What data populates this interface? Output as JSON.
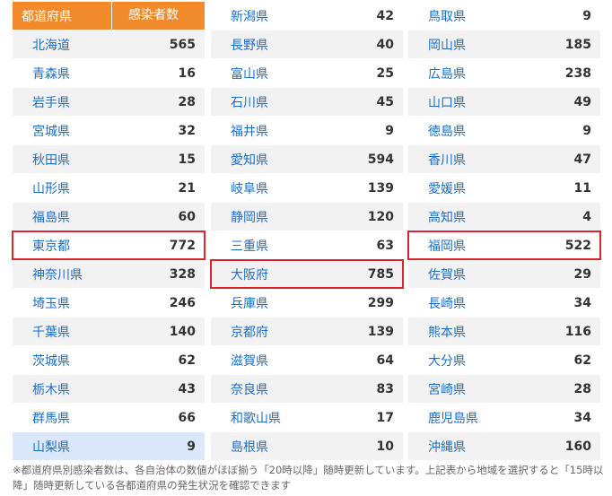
{
  "header": {
    "prefecture": "都道府県",
    "cases": "感染者数"
  },
  "columns": [
    [
      {
        "name": "北海道",
        "value": "565"
      },
      {
        "name": "青森県",
        "value": "16"
      },
      {
        "name": "岩手県",
        "value": "28"
      },
      {
        "name": "宮城県",
        "value": "32"
      },
      {
        "name": "秋田県",
        "value": "15"
      },
      {
        "name": "山形県",
        "value": "21"
      },
      {
        "name": "福島県",
        "value": "60"
      },
      {
        "name": "東京都",
        "value": "772"
      },
      {
        "name": "神奈川県",
        "value": "328"
      },
      {
        "name": "埼玉県",
        "value": "246"
      },
      {
        "name": "千葉県",
        "value": "140"
      },
      {
        "name": "茨城県",
        "value": "62"
      },
      {
        "name": "栃木県",
        "value": "43"
      },
      {
        "name": "群馬県",
        "value": "66"
      },
      {
        "name": "山梨県",
        "value": "9"
      }
    ],
    [
      {
        "name": "新潟県",
        "value": "42"
      },
      {
        "name": "長野県",
        "value": "40"
      },
      {
        "name": "富山県",
        "value": "25"
      },
      {
        "name": "石川県",
        "value": "45"
      },
      {
        "name": "福井県",
        "value": "9"
      },
      {
        "name": "愛知県",
        "value": "594"
      },
      {
        "name": "岐阜県",
        "value": "139"
      },
      {
        "name": "静岡県",
        "value": "120"
      },
      {
        "name": "三重県",
        "value": "63"
      },
      {
        "name": "大阪府",
        "value": "785"
      },
      {
        "name": "兵庫県",
        "value": "299"
      },
      {
        "name": "京都府",
        "value": "139"
      },
      {
        "name": "滋賀県",
        "value": "64"
      },
      {
        "name": "奈良県",
        "value": "83"
      },
      {
        "name": "和歌山県",
        "value": "17"
      },
      {
        "name": "島根県",
        "value": "10"
      }
    ],
    [
      {
        "name": "鳥取県",
        "value": "9"
      },
      {
        "name": "岡山県",
        "value": "185"
      },
      {
        "name": "広島県",
        "value": "238"
      },
      {
        "name": "山口県",
        "value": "49"
      },
      {
        "name": "徳島県",
        "value": "9"
      },
      {
        "name": "香川県",
        "value": "47"
      },
      {
        "name": "愛媛県",
        "value": "11"
      },
      {
        "name": "高知県",
        "value": "4"
      },
      {
        "name": "福岡県",
        "value": "522"
      },
      {
        "name": "佐賀県",
        "value": "29"
      },
      {
        "name": "長崎県",
        "value": "34"
      },
      {
        "name": "熊本県",
        "value": "116"
      },
      {
        "name": "大分県",
        "value": "62"
      },
      {
        "name": "宮崎県",
        "value": "28"
      },
      {
        "name": "鹿児島県",
        "value": "34"
      },
      {
        "name": "沖縄県",
        "value": "160"
      }
    ]
  ],
  "highlighted": [
    "東京都",
    "大阪府",
    "福岡県"
  ],
  "selected": "山梨県",
  "note": "※都道府県別感染者数は、各自治体の数値がほぼ揃う「20時以降」随時更新しています。上記表から地域を選択すると「15時以降」随時更新している各都道府県の発生状況を確認できます",
  "colors": {
    "header": "#f08a2b",
    "link": "#1a6fc4",
    "highlight": "#d9252f",
    "selected": "#dbe8fb"
  }
}
